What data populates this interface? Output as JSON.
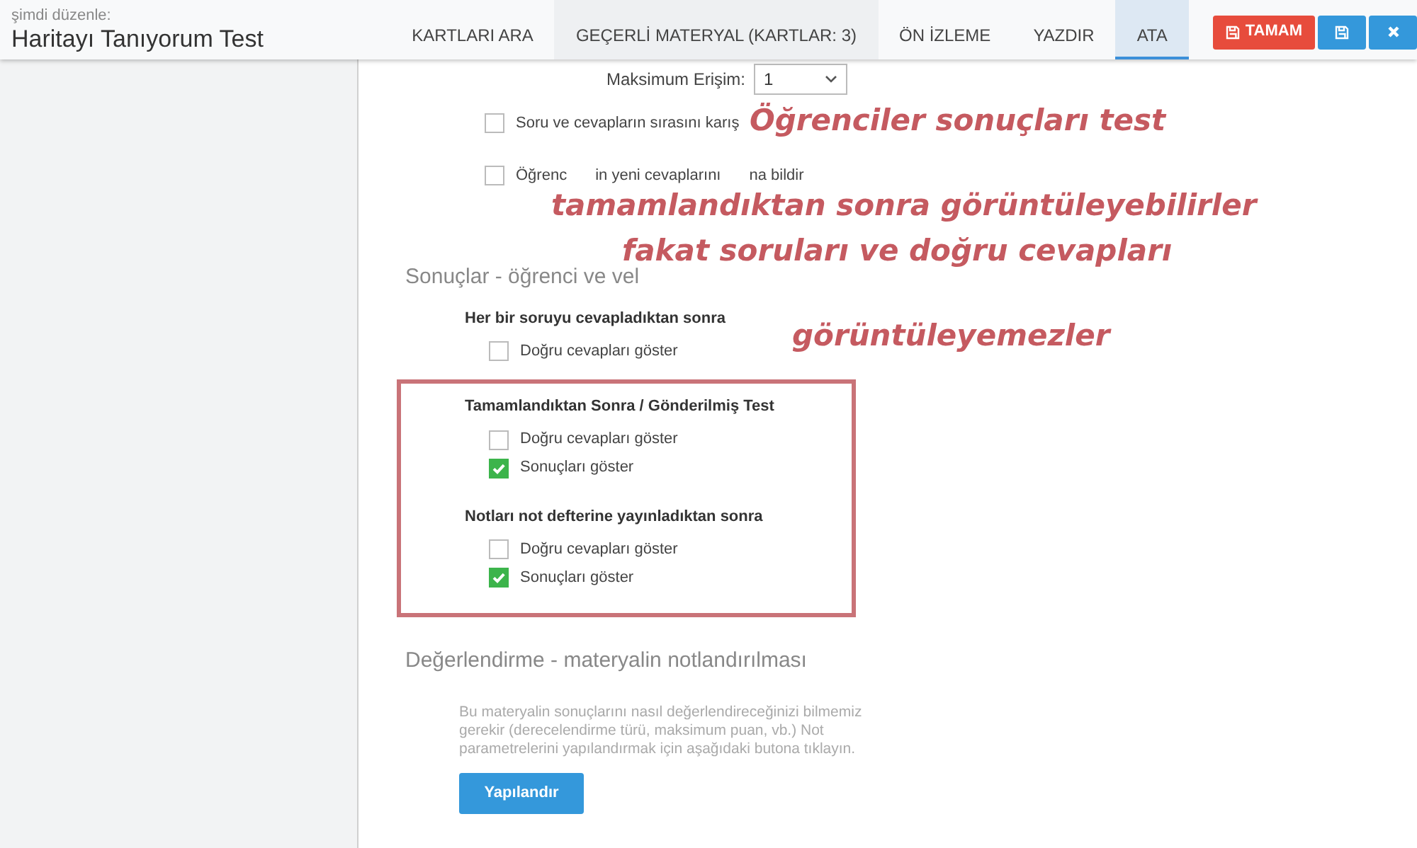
{
  "header": {
    "subtitle": "şimdi düzenle:",
    "title": "Haritayı Tanıyorum Test",
    "tabs": [
      {
        "label": "KARTLARI ARA",
        "selected": false
      },
      {
        "label": "GEÇERLİ MATERYAL (KARTLAR: 3)",
        "selected": false
      },
      {
        "label": "ÖN İZLEME",
        "selected": false
      },
      {
        "label": "YAZDIR",
        "selected": false
      },
      {
        "label": "ATA",
        "selected": true
      }
    ],
    "done_button": "TAMAM"
  },
  "max_access": {
    "label": "Maksimum Erişim:",
    "value": "1"
  },
  "options": [
    {
      "label_parts": [
        "Soru ve cevapların sırasını karış"
      ],
      "checked": false
    },
    {
      "label_parts": [
        "Öğrenc",
        "in yeni cevaplarını",
        "na bildir"
      ],
      "checked": false
    }
  ],
  "results": {
    "heading": "Sonuçlar - öğrenci ve vel",
    "groups": [
      {
        "title": "Her bir soruyu cevapladıktan sonra",
        "highlighted": false,
        "items": [
          {
            "label": "Doğru cevapları göster",
            "checked": false
          }
        ]
      },
      {
        "title": "Tamamlandıktan Sonra / Gönderilmiş Test",
        "highlighted": true,
        "items": [
          {
            "label": "Doğru cevapları göster",
            "checked": false
          },
          {
            "label": "Sonuçları göster",
            "checked": true
          }
        ]
      },
      {
        "title": "Notları not defterine yayınladıktan sonra",
        "highlighted": true,
        "items": [
          {
            "label": "Doğru cevapları göster",
            "checked": false
          },
          {
            "label": "Sonuçları göster",
            "checked": true
          }
        ]
      }
    ]
  },
  "grading": {
    "heading": "Değerlendirme - materyalin notlandırılması",
    "text": "Bu materyalin sonuçlarını nasıl değerlendireceğinizi bilmemiz gerekir (derecelendirme türü, maksimum puan, vb.) Not parametrelerini yapılandırmak için aşağıdaki butona tıklayın.",
    "button": "Yapılandır"
  },
  "annotation": [
    "Öğrenciler sonuçları test",
    "tamamlandıktan sonra görüntüleyebilirler",
    "fakat soruları ve doğru cevapları",
    "görüntüleyemezler"
  ]
}
